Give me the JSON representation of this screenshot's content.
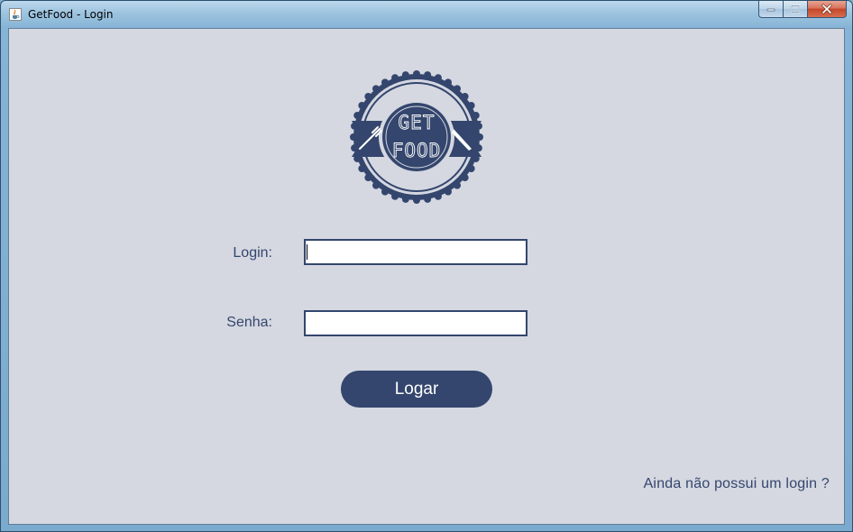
{
  "window": {
    "title": "GetFood - Login",
    "icon": "java-cup-icon",
    "controls": [
      "minimize-icon",
      "maximize-icon",
      "close-icon"
    ]
  },
  "logo": {
    "top_text": "GET",
    "bottom_text": "FOOD",
    "left_icon": "fork-icon",
    "right_icon": "knife-icon"
  },
  "form": {
    "login_label": "Login:",
    "login_value": "",
    "senha_label": "Senha:",
    "senha_value": "",
    "submit_label": "Logar"
  },
  "footer": {
    "register_link": "Ainda não possui um login ?"
  },
  "colors": {
    "accent": "#34466d",
    "background": "#d5d8e1"
  }
}
